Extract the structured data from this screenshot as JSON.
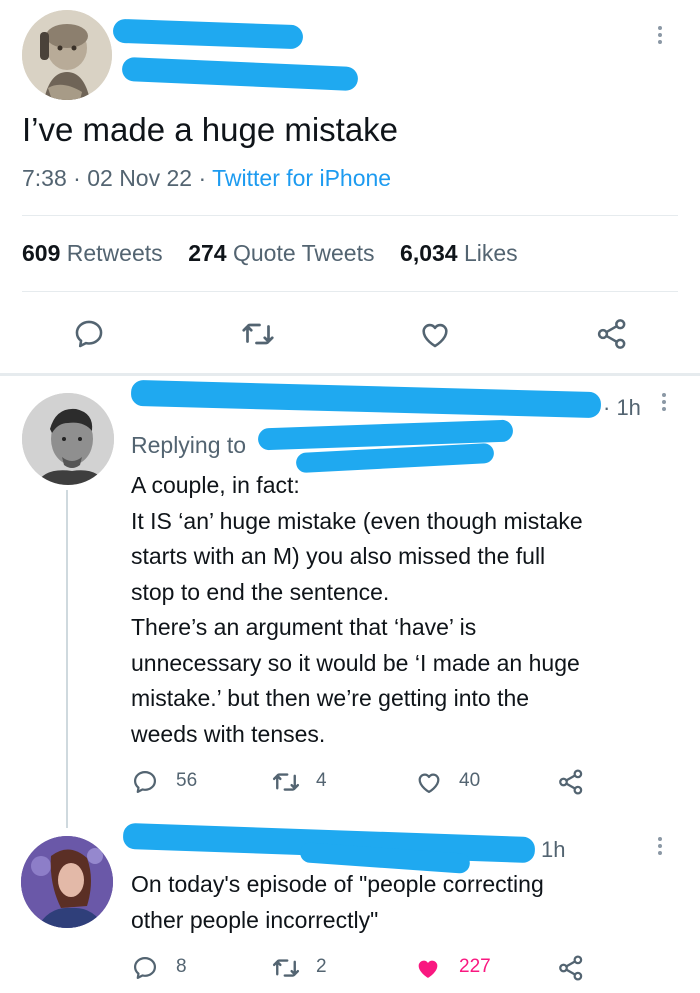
{
  "main_tweet": {
    "text": "I’ve made a huge mistake",
    "time": "7:38",
    "date": "02 Nov 22",
    "source": "Twitter for iPhone",
    "sep1": "·",
    "sep2": "·",
    "stats": {
      "retweets": "609",
      "retweets_label": "Retweets",
      "quotes": "274",
      "quotes_label": "Quote Tweets",
      "likes": "6,034",
      "likes_label": "Likes"
    }
  },
  "reply1": {
    "time": "· 1h",
    "replying_prefix": "Replying to",
    "lines": [
      "A couple, in fact:",
      "It IS ‘an’ huge mistake (even though mistake",
      "starts with an M) you also missed the full",
      "stop to end the sentence.",
      "There’s an argument that ‘have’ is",
      "unnecessary so it would be ‘I made an huge",
      "mistake.’ but then we’re getting into the",
      "weeds with tenses."
    ],
    "replies": "56",
    "retweets": "4",
    "likes": "40"
  },
  "reply2": {
    "time": "1h",
    "lines": [
      "On today's episode of \"people correcting",
      "other people incorrectly\""
    ],
    "replies": "8",
    "retweets": "2",
    "likes": "227",
    "liked_color": "#f91880"
  },
  "colors": {
    "redaction": "#1fa9f0",
    "link": "#1d9bf0",
    "muted": "#536471"
  }
}
